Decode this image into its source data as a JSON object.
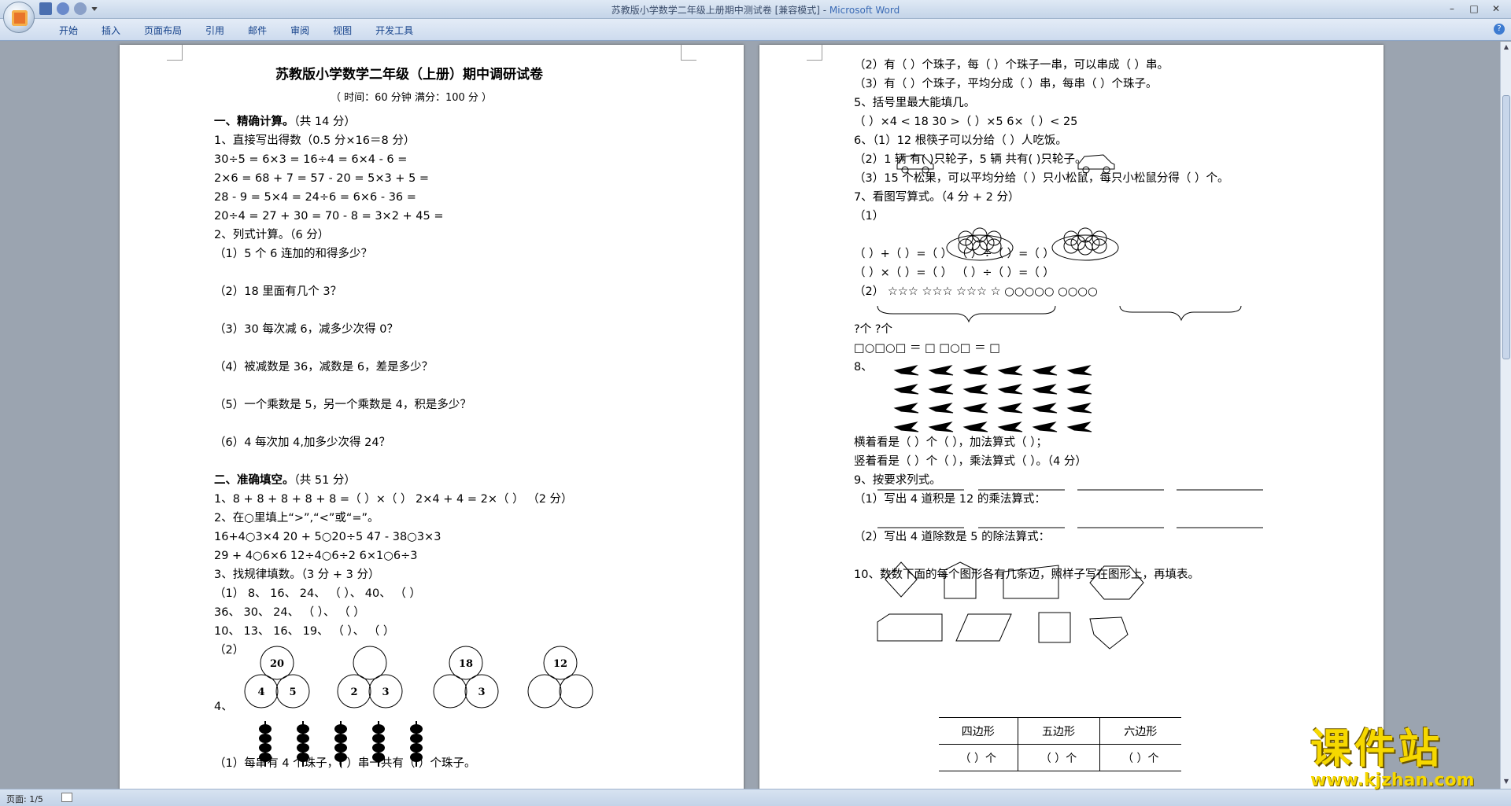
{
  "window": {
    "title_doc": "苏教版小学数学二年级上册期中测试卷 [兼容模式] - ",
    "title_app": "Microsoft Word",
    "controls": [
      "–",
      "□",
      "✕"
    ]
  },
  "ribbon": {
    "tabs": [
      "开始",
      "插入",
      "页面布局",
      "引用",
      "邮件",
      "审阅",
      "视图",
      "开发工具"
    ],
    "help": "?"
  },
  "status": {
    "page_info": "页面: 1/5"
  },
  "watermark": {
    "main": "课件站",
    "url": "www.kjzhan.com"
  },
  "left_page": {
    "title": "苏教版小学数学二年级（上册）期中调研试卷",
    "subtitle": "（ 时间：60 分钟      满分：100 分 ）",
    "lines": [
      {
        "t": "一、精确计算。",
        "bold": true,
        "tail": "（共 14 分）"
      },
      {
        "t": "1、直接写出得数（0.5 分×16＝8 分）"
      },
      {
        "t": "  30÷5 =            6×3 =            16÷4 =              6×4 - 6 ="
      },
      {
        "t": "  2×6 =             68 + 7 =          57 - 20 =             5×3 + 5 ="
      },
      {
        "t": "  28 - 9 =            5×4 =              24÷6 =               6×6 - 36 ="
      },
      {
        "t": "  20÷4 =             27 + 30 =          70 - 8 =                3×2 + 45 ="
      },
      {
        "t": "2、列式计算。（6 分）"
      },
      {
        "t": "（1）5 个 6 连加的和得多少？"
      },
      {
        "t": ""
      },
      {
        "t": "（2）18 里面有几个 3？"
      },
      {
        "t": ""
      },
      {
        "t": "（3）30 每次减 6，减多少次得 0？"
      },
      {
        "t": ""
      },
      {
        "t": "（4）被减数是 36，减数是 6，差是多少？"
      },
      {
        "t": ""
      },
      {
        "t": "（5）一个乘数是 5，另一个乘数是 4，积是多少？"
      },
      {
        "t": ""
      },
      {
        "t": "（6）4 每次加 4,加多少次得 24？"
      },
      {
        "t": ""
      },
      {
        "t": "二、准确填空。",
        "bold": true,
        "tail": "（共 51 分）"
      },
      {
        "t": "1、8 + 8 + 8 + 8 + 8 =（        ）×（        ）      2×4 + 4 = 2×（        ）   （2 分）"
      },
      {
        "t": "2、在○里填上“>”,“<”或“=”。"
      },
      {
        "t": "  16+4○3×4          20 + 5○20÷5          47 - 38○3×3"
      },
      {
        "t": "  29 + 4○6×6          12÷4○6÷2            6×1○6÷3"
      },
      {
        "t": "3、找规律填数。（3 分 + 3 分）"
      },
      {
        "t": "（1） 8、   16、   24、   （        ）、  40、   （        ）"
      },
      {
        "t": "         36、    30、    24、   （        ）、   （        ）"
      },
      {
        "t": "         10、    13、    16、    19、    （        ）、  （        ）"
      },
      {
        "t": "（2）"
      },
      {
        "t": ""
      },
      {
        "t": ""
      },
      {
        "t": "4、"
      },
      {
        "t": ""
      },
      {
        "t": ""
      },
      {
        "t": "（1）每串有 4 个珠子，(        ）串一共有（        ）个珠子。"
      }
    ],
    "circles": [
      {
        "top": "20",
        "bl": "4",
        "br": "5"
      },
      {
        "top": "",
        "bl": "2",
        "br": "3"
      },
      {
        "top": "18",
        "bl": "",
        "br": "3"
      },
      {
        "top": "12",
        "bl": "",
        "br": ""
      }
    ]
  },
  "right_page": {
    "lines": [
      {
        "t": "（2）有（       ）个珠子，每（       ）个珠子一串，可以串成（       ）串。"
      },
      {
        "t": "（3）有（       ）个珠子，平均分成（        ）串，每串（        ）个珠子。"
      },
      {
        "t": "5、括号里最大能填几。"
      },
      {
        "t": "   （     ）×4 < 18              30 >（     ）×5             6×（     ）< 25"
      },
      {
        "t": "6、（1）12 根筷子可以分给（      ）人吃饭。"
      },
      {
        "t": "（2）1 辆            有(      )只轮子，5 辆            共有(      )只轮子。"
      },
      {
        "t": "（3）15 个松果，可以平均分给（      ）只小松鼠，每只小松鼠分得（        ）个。"
      },
      {
        "t": "7、看图写算式。（4 分 + 2 分）"
      },
      {
        "t": "（1）"
      },
      {
        "t": ""
      },
      {
        "t": "        （      ）+（        ）=（        ）        （        ）÷（        ）=（        ）"
      },
      {
        "t": "        （      ）×（        ）=（        ）        （        ）÷（        ）=（        ）"
      },
      {
        "t": "（2） ☆☆☆   ☆☆☆   ☆☆☆    ☆                      ○○○○○    ○○○○"
      },
      {
        "t": ""
      },
      {
        "t": "                            ?个                                                          ?个"
      },
      {
        "t": "            □○□○□ ＝ □                                □○□ ＝ □"
      },
      {
        "t": "8、"
      },
      {
        "t": ""
      },
      {
        "t": ""
      },
      {
        "t": ""
      },
      {
        "t": "      横着看是（        ）个（        ），加法算式（                                      ）；"
      },
      {
        "t": "      竖着看是（        ）个（        ），乘法算式（                                      ）。（4 分）"
      },
      {
        "t": "9、按要求列式。"
      },
      {
        "t": "（1）写出 4 道积是 12 的乘法算式："
      },
      {
        "t": ""
      },
      {
        "t": "（2）写出 4 道除数是 5 的除法算式："
      },
      {
        "t": ""
      },
      {
        "t": "10、数数下面的每个图形各有几条边，照样子写在图形上，再填表。"
      }
    ],
    "table": {
      "headers": [
        "四边形",
        "五边形",
        "六边形"
      ],
      "cells": [
        "（      ）个",
        "（      ）个",
        "（      ）个"
      ]
    }
  }
}
